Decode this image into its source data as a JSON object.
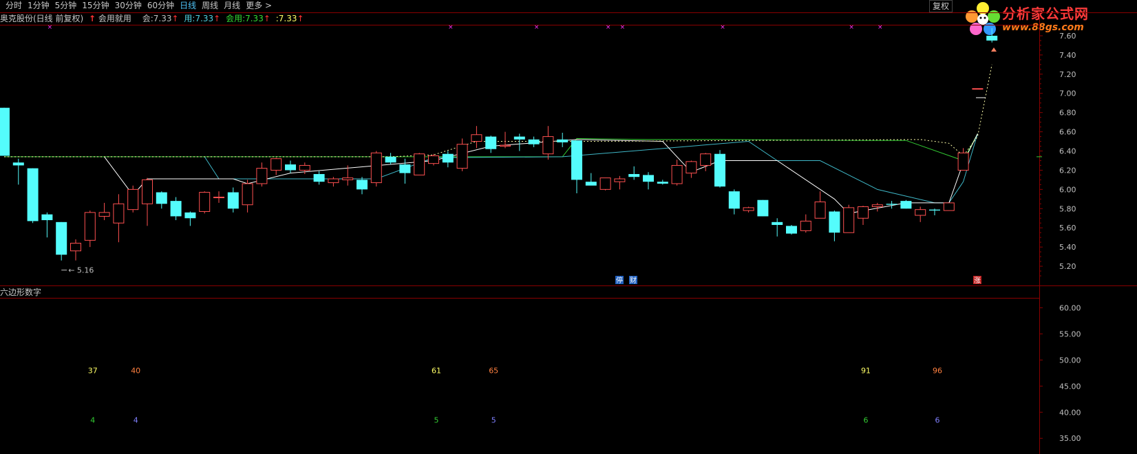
{
  "toolbar": {
    "periods": [
      "分时",
      "1分钟",
      "5分钟",
      "15分钟",
      "30分钟",
      "60分钟",
      "日线",
      "周线",
      "月线",
      "更多 >"
    ],
    "active_period": "日线",
    "restore_button": "复权"
  },
  "logo": {
    "brand": "分析家公式网",
    "url": "www.88gs.com"
  },
  "info": {
    "stock": "奥克股份(日线 前复权)",
    "indicator": "会用就用",
    "hui_label": "会:",
    "hui_value": "7.33",
    "yong_label": "用:",
    "yong_value": "7.33",
    "huiyong_label": "会用:",
    "huiyong_value": "7.33",
    "blank_label": ":",
    "blank_value": "7.33",
    "up_arrow": "↑",
    "colors": {
      "hui": "#c0c0c0",
      "yong": "#4fd0e0",
      "huiyong": "#33dd33",
      "blank": "#ffff66",
      "arrow": "#ff3333"
    }
  },
  "colors": {
    "up": "#ff5050",
    "down": "#54fcfc",
    "grid": "#8b0000",
    "ma_white": "#ffffff",
    "ma_green": "#33cc33",
    "ma_cyan": "#3fb8c8",
    "ma_yellow": "#ffffaa",
    "magenta": "#ff33ff"
  },
  "chart_data": [
    {
      "type": "candlestick",
      "title": "奥克股份(日线 前复权)",
      "ylim": [
        5.05,
        7.7
      ],
      "yticks": [
        "7.60",
        "7.40",
        "7.20",
        "7.00",
        "6.80",
        "6.60",
        "6.40",
        "6.20",
        "6.00",
        "5.80",
        "5.60",
        "5.40",
        "5.20"
      ],
      "low_marker": "5.16",
      "candles": [
        [
          6.85,
          6.85,
          6.35,
          6.35
        ],
        [
          6.28,
          6.32,
          6.05,
          6.25
        ],
        [
          6.22,
          6.22,
          5.65,
          5.67
        ],
        [
          5.74,
          5.76,
          5.5,
          5.68
        ],
        [
          5.66,
          5.66,
          5.26,
          5.32
        ],
        [
          5.36,
          5.48,
          5.26,
          5.44
        ],
        [
          5.47,
          5.78,
          5.4,
          5.76
        ],
        [
          5.72,
          5.86,
          5.68,
          5.76
        ],
        [
          5.65,
          5.95,
          5.45,
          5.85
        ],
        [
          5.79,
          6.04,
          5.76,
          6.0
        ],
        [
          5.85,
          6.12,
          5.62,
          6.1
        ],
        [
          5.97,
          5.98,
          5.8,
          5.85
        ],
        [
          5.88,
          5.92,
          5.68,
          5.72
        ],
        [
          5.76,
          5.77,
          5.62,
          5.7
        ],
        [
          5.77,
          5.98,
          5.75,
          5.97
        ],
        [
          5.92,
          5.98,
          5.86,
          5.92
        ],
        [
          5.97,
          6.02,
          5.76,
          5.8
        ],
        [
          5.84,
          6.1,
          5.76,
          6.06
        ],
        [
          6.06,
          6.28,
          6.03,
          6.22
        ],
        [
          6.2,
          6.33,
          6.15,
          6.32
        ],
        [
          6.26,
          6.3,
          6.17,
          6.2
        ],
        [
          6.2,
          6.28,
          6.16,
          6.25
        ],
        [
          6.16,
          6.19,
          6.05,
          6.08
        ],
        [
          6.07,
          6.13,
          6.03,
          6.11
        ],
        [
          6.1,
          6.25,
          6.04,
          6.12
        ],
        [
          6.1,
          6.13,
          5.95,
          6.0
        ],
        [
          6.07,
          6.4,
          6.03,
          6.38
        ],
        [
          6.34,
          6.38,
          6.26,
          6.28
        ],
        [
          6.26,
          6.32,
          6.06,
          6.17
        ],
        [
          6.15,
          6.38,
          6.15,
          6.37
        ],
        [
          6.27,
          6.37,
          6.25,
          6.35
        ],
        [
          6.37,
          6.4,
          6.23,
          6.28
        ],
        [
          6.22,
          6.53,
          6.19,
          6.47
        ],
        [
          6.5,
          6.66,
          6.43,
          6.57
        ],
        [
          6.55,
          6.56,
          6.38,
          6.42
        ],
        [
          6.45,
          6.6,
          6.43,
          6.46
        ],
        [
          6.55,
          6.58,
          6.4,
          6.52
        ],
        [
          6.52,
          6.55,
          6.44,
          6.47
        ],
        [
          6.37,
          6.66,
          6.31,
          6.55
        ],
        [
          6.52,
          6.59,
          6.44,
          6.49
        ],
        [
          6.51,
          6.51,
          5.96,
          6.1
        ],
        [
          6.08,
          6.17,
          6.05,
          6.04
        ],
        [
          6.0,
          6.12,
          5.99,
          6.12
        ],
        [
          6.08,
          6.14,
          6.0,
          6.11
        ],
        [
          6.16,
          6.24,
          6.1,
          6.13
        ],
        [
          6.15,
          6.18,
          6.0,
          6.08
        ],
        [
          6.08,
          6.1,
          6.05,
          6.06
        ],
        [
          6.06,
          6.31,
          6.04,
          6.25
        ],
        [
          6.17,
          6.3,
          6.12,
          6.29
        ],
        [
          6.25,
          6.38,
          6.19,
          6.37
        ],
        [
          6.37,
          6.41,
          6.02,
          6.03
        ],
        [
          5.98,
          6.0,
          5.74,
          5.8
        ],
        [
          5.78,
          5.82,
          5.76,
          5.81
        ],
        [
          5.89,
          5.89,
          5.72,
          5.72
        ],
        [
          5.66,
          5.7,
          5.51,
          5.63
        ],
        [
          5.62,
          5.63,
          5.53,
          5.54
        ],
        [
          5.57,
          5.74,
          5.55,
          5.67
        ],
        [
          5.7,
          5.98,
          5.7,
          5.87
        ],
        [
          5.77,
          5.78,
          5.46,
          5.55
        ],
        [
          5.55,
          5.84,
          5.55,
          5.81
        ],
        [
          5.7,
          5.83,
          5.63,
          5.82
        ],
        [
          5.82,
          5.86,
          5.77,
          5.84
        ],
        [
          5.85,
          5.88,
          5.8,
          5.84
        ],
        [
          5.88,
          5.89,
          5.8,
          5.8
        ],
        [
          5.73,
          5.82,
          5.66,
          5.79
        ],
        [
          5.79,
          5.8,
          5.73,
          5.78
        ],
        [
          5.78,
          5.86,
          5.78,
          5.86
        ],
        [
          6.2,
          6.43,
          6.2,
          6.38
        ],
        [
          7.05,
          7.05,
          7.05,
          7.05
        ],
        [
          7.6,
          7.68,
          7.53,
          7.55
        ]
      ],
      "ma_white": [
        [
          7,
          6.34
        ],
        [
          9,
          5.94
        ],
        [
          10,
          6.11
        ],
        [
          16,
          6.11
        ],
        [
          17,
          6.06
        ],
        [
          20,
          6.17
        ],
        [
          30,
          6.3
        ],
        [
          34,
          6.45
        ],
        [
          40,
          6.52
        ],
        [
          46,
          6.5
        ],
        [
          48,
          6.18
        ],
        [
          50,
          6.3
        ],
        [
          54,
          6.3
        ],
        [
          58,
          5.9
        ],
        [
          59,
          5.75
        ],
        [
          63,
          5.86
        ],
        [
          66,
          5.86
        ],
        [
          67,
          6.28
        ],
        [
          68,
          6.58
        ]
      ],
      "ma_green": [
        [
          0,
          6.34
        ],
        [
          39,
          6.34
        ],
        [
          40,
          6.53
        ],
        [
          45,
          6.52
        ],
        [
          50,
          6.52
        ],
        [
          60,
          6.51
        ],
        [
          63,
          6.51
        ],
        [
          67,
          6.3
        ],
        [
          68,
          6.58
        ]
      ],
      "ma_cyan": [
        [
          14,
          6.34
        ],
        [
          15,
          6.11
        ],
        [
          26,
          6.11
        ],
        [
          30,
          6.33
        ],
        [
          39,
          6.34
        ],
        [
          52,
          6.5
        ],
        [
          54,
          6.3
        ],
        [
          57,
          6.3
        ],
        [
          61,
          6.0
        ],
        [
          65,
          5.86
        ],
        [
          66,
          5.86
        ],
        [
          67,
          6.08
        ],
        [
          68,
          6.58
        ]
      ],
      "ma_yellow_dotted": [
        [
          0,
          6.34
        ],
        [
          27,
          6.34
        ],
        [
          30,
          6.36
        ],
        [
          33,
          6.5
        ],
        [
          41,
          6.5
        ],
        [
          64,
          6.52
        ],
        [
          66,
          6.48
        ],
        [
          67,
          6.35
        ],
        [
          68,
          6.55
        ],
        [
          69,
          7.3
        ]
      ],
      "markers": {
        "ting": "停",
        "cai": "财",
        "zhang": "涨"
      }
    },
    {
      "type": "scatter",
      "title": "六边形数字",
      "ylim": [
        32,
        61.5
      ],
      "yticks": [
        "60.00",
        "55.00",
        "50.00",
        "45.00",
        "40.00",
        "35.00"
      ],
      "labels": [
        {
          "x": 6,
          "y": 48,
          "text": "37",
          "color": "#ffff66"
        },
        {
          "x": 9,
          "y": 48,
          "text": "40",
          "color": "#ff8040"
        },
        {
          "x": 30,
          "y": 48,
          "text": "61",
          "color": "#ffff66"
        },
        {
          "x": 34,
          "y": 48,
          "text": "65",
          "color": "#ff8040"
        },
        {
          "x": 60,
          "y": 48,
          "text": "91",
          "color": "#ffff66"
        },
        {
          "x": 65,
          "y": 48,
          "text": "96",
          "color": "#ff8040"
        },
        {
          "x": 6,
          "y": 38.5,
          "text": "4",
          "color": "#33cc33"
        },
        {
          "x": 9,
          "y": 38.5,
          "text": "4",
          "color": "#8080ff"
        },
        {
          "x": 30,
          "y": 38.5,
          "text": "5",
          "color": "#33cc33"
        },
        {
          "x": 34,
          "y": 38.5,
          "text": "5",
          "color": "#8080ff"
        },
        {
          "x": 60,
          "y": 38.5,
          "text": "6",
          "color": "#33cc33"
        },
        {
          "x": 65,
          "y": 38.5,
          "text": "6",
          "color": "#8080ff"
        }
      ]
    }
  ]
}
